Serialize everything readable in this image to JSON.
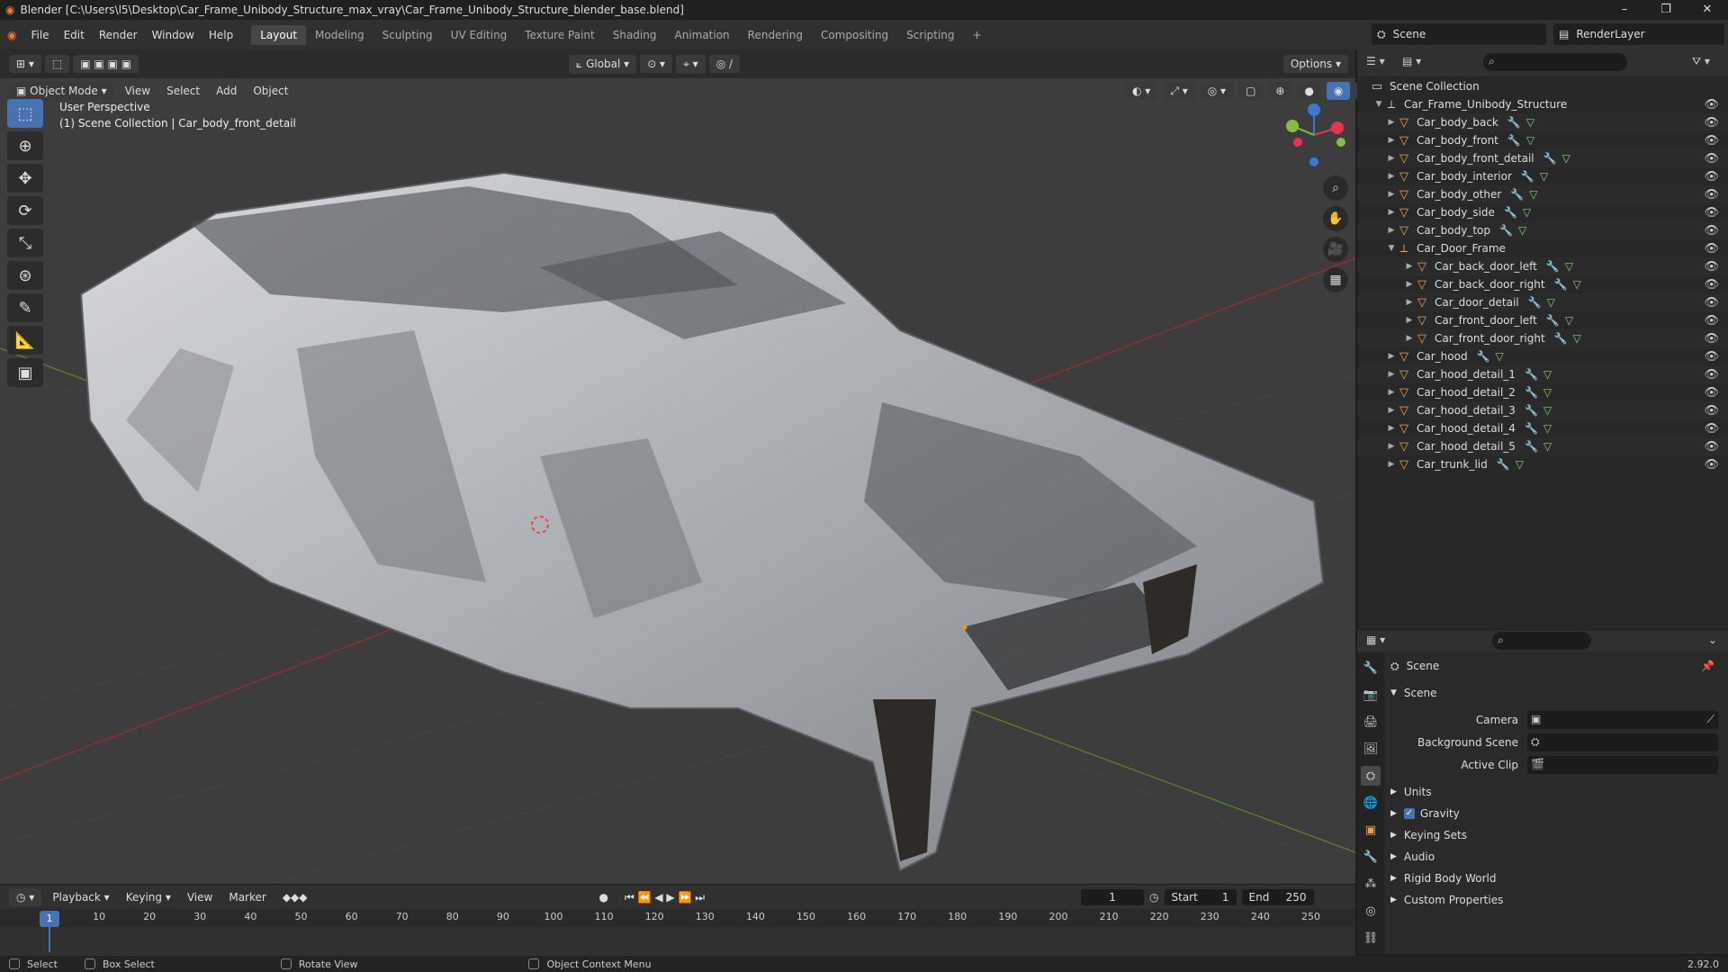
{
  "window": {
    "title": "Blender [C:\\Users\\l5\\Desktop\\Car_Frame_Unibody_Structure_max_vray\\Car_Frame_Unibody_Structure_blender_base.blend]",
    "controls": [
      "–",
      "❐",
      "✕"
    ]
  },
  "menubar": [
    "File",
    "Edit",
    "Render",
    "Window",
    "Help"
  ],
  "workspaces": [
    "Layout",
    "Modeling",
    "Sculpting",
    "UV Editing",
    "Texture Paint",
    "Shading",
    "Animation",
    "Rendering",
    "Compositing",
    "Scripting"
  ],
  "active_workspace": "Layout",
  "scene_selector": "Scene",
  "layer_selector": "RenderLayer",
  "viewport": {
    "mode": "Object Mode",
    "menus": [
      "View",
      "Select",
      "Add",
      "Object"
    ],
    "transform_orientation": "Global",
    "options_label": "Options",
    "perspective_label": "User Perspective",
    "collection_label": "(1) Scene Collection | Car_body_front_detail"
  },
  "outliner": {
    "root": "Scene Collection",
    "collection": "Car_Frame_Unibody_Structure",
    "items": [
      {
        "name": "Car_body_back",
        "indent": 1
      },
      {
        "name": "Car_body_front",
        "indent": 1
      },
      {
        "name": "Car_body_front_detail",
        "indent": 1
      },
      {
        "name": "Car_body_interior",
        "indent": 1
      },
      {
        "name": "Car_body_other",
        "indent": 1
      },
      {
        "name": "Car_body_side",
        "indent": 1
      },
      {
        "name": "Car_body_top",
        "indent": 1
      },
      {
        "name": "Car_Door_Frame",
        "indent": 1
      },
      {
        "name": "Car_back_door_left",
        "indent": 2
      },
      {
        "name": "Car_back_door_right",
        "indent": 2
      },
      {
        "name": "Car_door_detail",
        "indent": 2
      },
      {
        "name": "Car_front_door_left",
        "indent": 2
      },
      {
        "name": "Car_front_door_right",
        "indent": 2
      },
      {
        "name": "Car_hood",
        "indent": 1
      },
      {
        "name": "Car_hood_detail_1",
        "indent": 1
      },
      {
        "name": "Car_hood_detail_2",
        "indent": 1
      },
      {
        "name": "Car_hood_detail_3",
        "indent": 1
      },
      {
        "name": "Car_hood_detail_4",
        "indent": 1
      },
      {
        "name": "Car_hood_detail_5",
        "indent": 1
      },
      {
        "name": "Car_trunk_lid",
        "indent": 1
      }
    ]
  },
  "properties": {
    "context": "Scene",
    "panel": "Scene",
    "fields": [
      {
        "label": "Camera"
      },
      {
        "label": "Background Scene"
      },
      {
        "label": "Active Clip"
      }
    ],
    "sections": [
      "Units",
      "Gravity",
      "Keying Sets",
      "Audio",
      "Rigid Body World",
      "Custom Properties"
    ]
  },
  "timeline": {
    "menus": [
      "Playback",
      "Keying",
      "View",
      "Marker"
    ],
    "current_frame": "1",
    "start_label": "Start",
    "start": "1",
    "end_label": "End",
    "end": "250",
    "ticks": [
      "10",
      "20",
      "30",
      "40",
      "50",
      "60",
      "70",
      "80",
      "90",
      "100",
      "110",
      "120",
      "130",
      "140",
      "150",
      "160",
      "170",
      "180",
      "190",
      "200",
      "210",
      "220",
      "230",
      "240",
      "250"
    ]
  },
  "statusbar": {
    "select": "Select",
    "box_select": "Box Select",
    "rotate_view": "Rotate View",
    "context_menu": "Object Context Menu",
    "version": "2.92.0"
  },
  "colors": {
    "accent": "#4772b3",
    "object_icon": "#f0a050",
    "modifier_icon": "#6a8ed8",
    "mesh_icon": "#7fd67a",
    "x_axis": "#e8344c",
    "y_axis": "#80c040",
    "z_axis": "#3c78d8"
  }
}
